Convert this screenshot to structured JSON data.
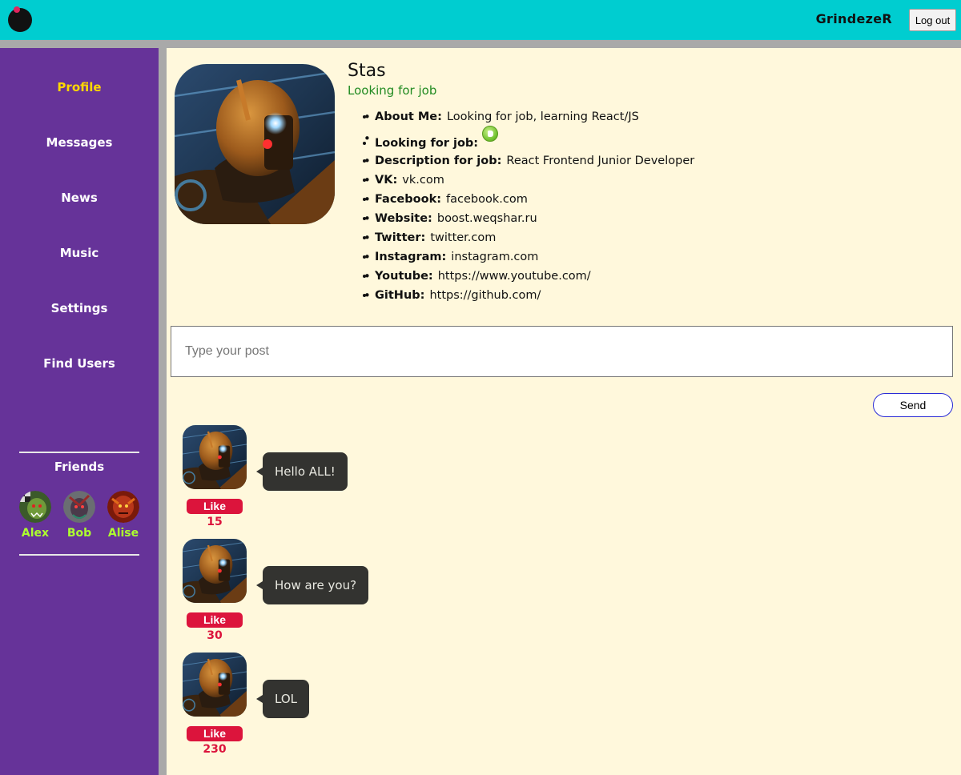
{
  "header": {
    "username": "GrindezeR",
    "logout_label": "Log out",
    "accent_color": "#00cdd0"
  },
  "sidebar": {
    "items": [
      {
        "label": "Profile",
        "active": true
      },
      {
        "label": "Messages",
        "active": false
      },
      {
        "label": "News",
        "active": false
      },
      {
        "label": "Music",
        "active": false
      },
      {
        "label": "Settings",
        "active": false
      },
      {
        "label": "Find Users",
        "active": false
      }
    ],
    "friends_title": "Friends",
    "friends": [
      {
        "name": "Alex",
        "avatar": "orc-avatar"
      },
      {
        "name": "Bob",
        "avatar": "undead-avatar"
      },
      {
        "name": "Alise",
        "avatar": "red-warrior-avatar"
      }
    ],
    "background_color": "#663399"
  },
  "profile": {
    "name": "Stas",
    "status": "Looking for job",
    "contacts": [
      {
        "key": "About Me:",
        "value": "Looking for job, learning React/JS"
      },
      {
        "key": "Looking for job:",
        "value": "",
        "icon": "thumbs-up-icon"
      },
      {
        "key": "Description for job:",
        "value": "React Frontend Junior Developer"
      },
      {
        "key": "VK:",
        "value": "vk.com"
      },
      {
        "key": "Facebook:",
        "value": "facebook.com"
      },
      {
        "key": "Website:",
        "value": "boost.weqshar.ru"
      },
      {
        "key": "Twitter:",
        "value": "twitter.com"
      },
      {
        "key": "Instagram:",
        "value": "instagram.com"
      },
      {
        "key": "Youtube:",
        "value": "https://www.youtube.com/"
      },
      {
        "key": "GitHub:",
        "value": "https://github.com/"
      }
    ]
  },
  "composer": {
    "placeholder": "Type your post",
    "send_label": "Send"
  },
  "posts": [
    {
      "message": "Hello ALL!",
      "like_label": "Like",
      "likes": "15"
    },
    {
      "message": "How are you?",
      "like_label": "Like",
      "likes": "30"
    },
    {
      "message": "LOL",
      "like_label": "Like",
      "likes": "230"
    }
  ]
}
